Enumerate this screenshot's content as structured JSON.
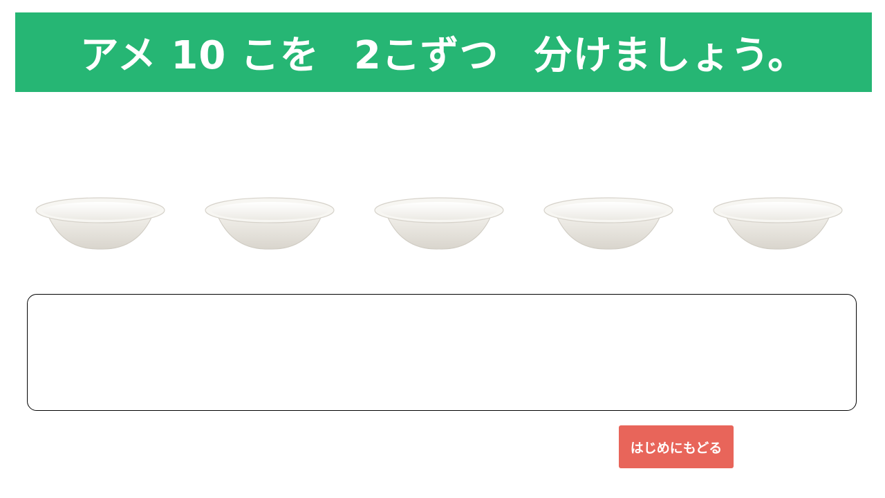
{
  "header": {
    "instruction_parts": [
      "アメ 10 こを",
      "2こずつ",
      "分けましょう。"
    ],
    "background_color": "#26b674"
  },
  "bowls": {
    "count": 5,
    "icon": "paper-bowl-icon"
  },
  "drop_area": {
    "label": ""
  },
  "footer": {
    "back_label": "はじめにもどる",
    "back_color": "#e8655a"
  }
}
